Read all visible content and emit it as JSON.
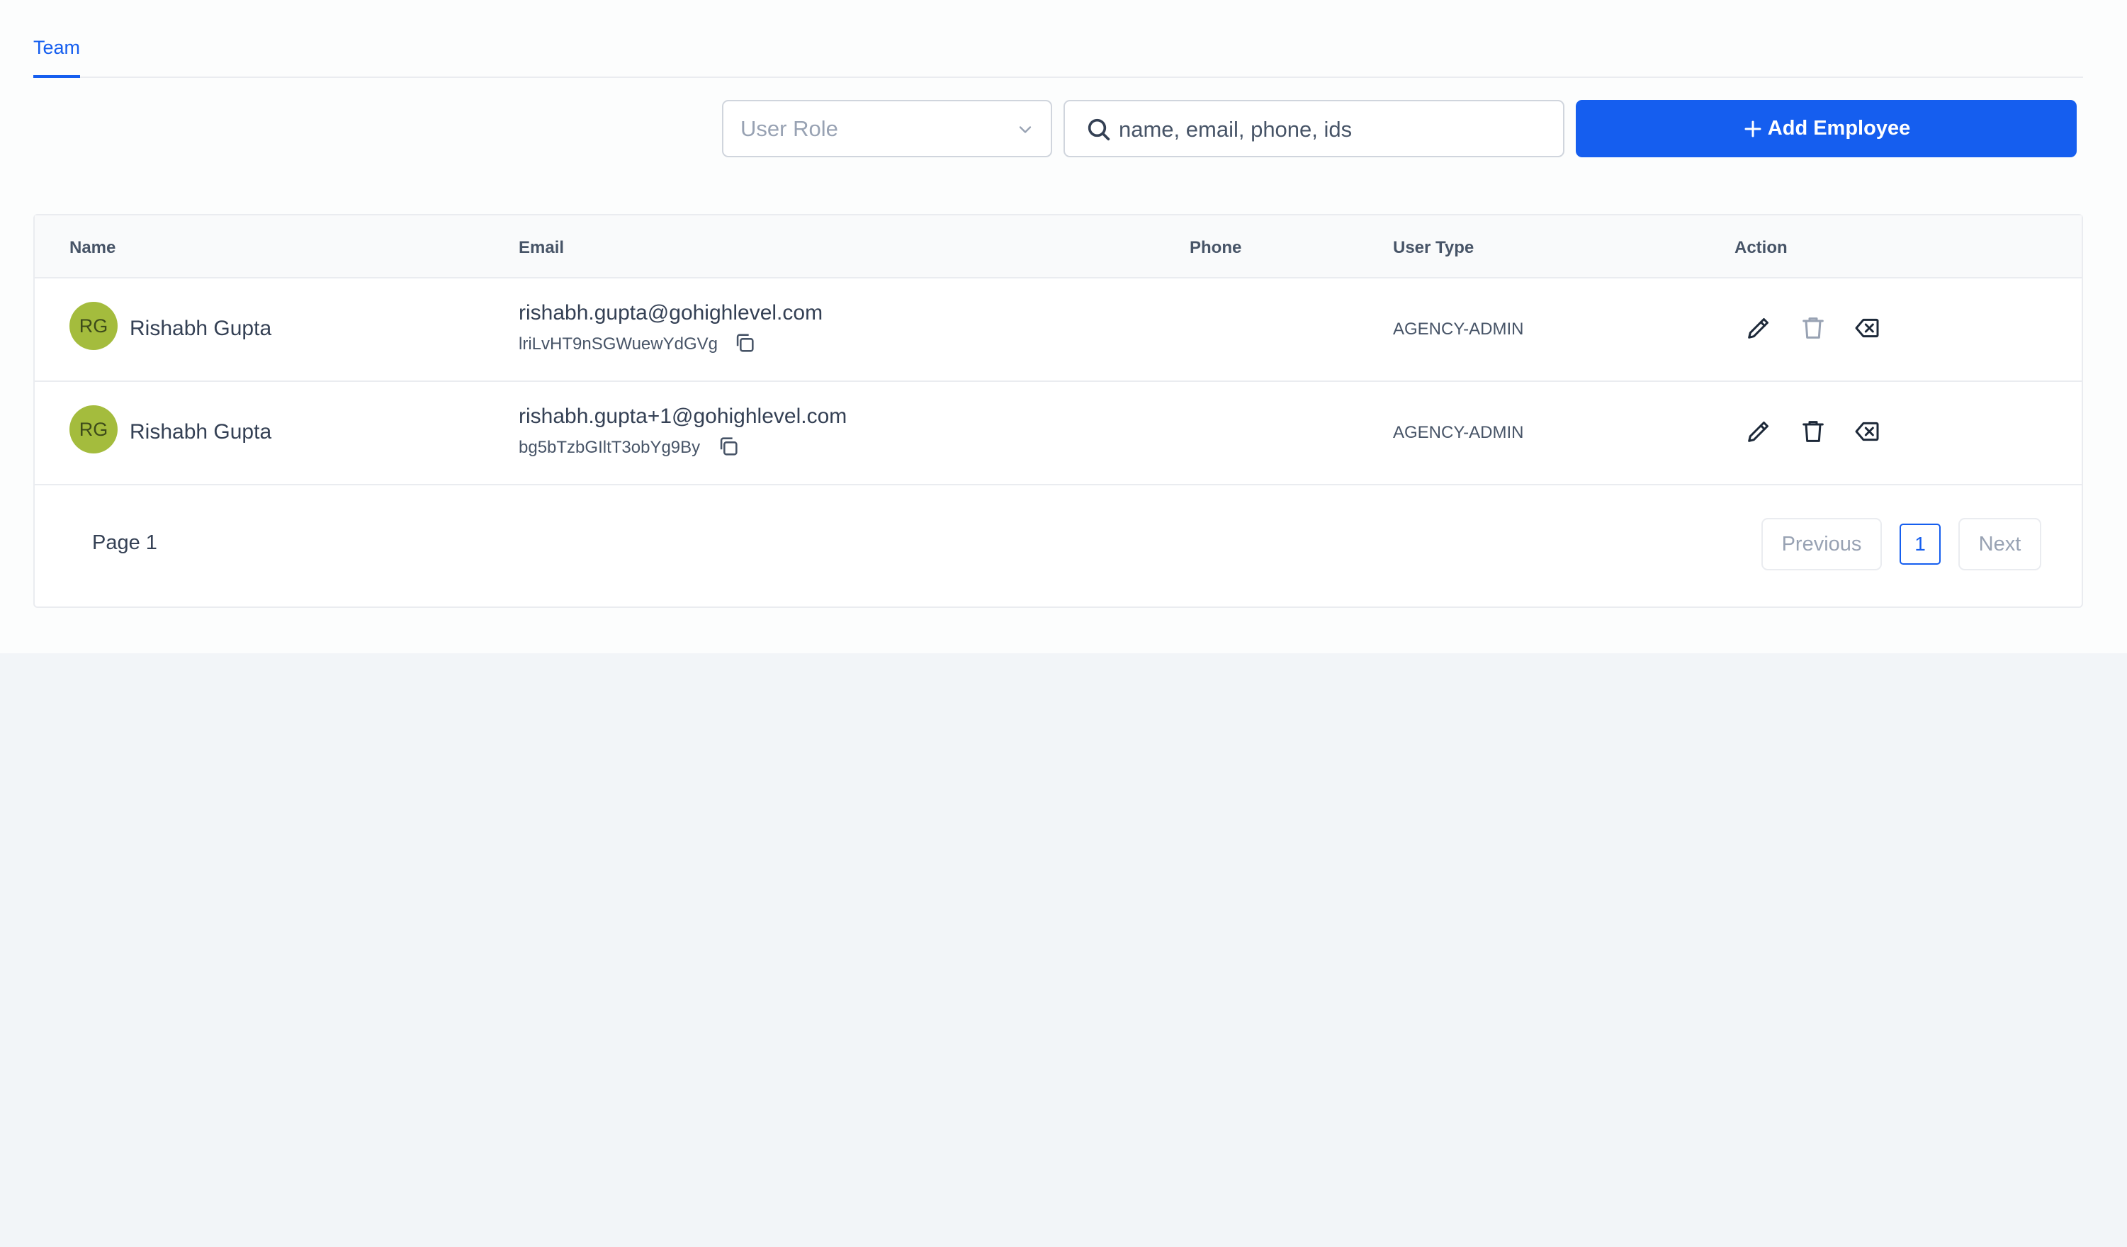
{
  "tabs": [
    {
      "label": "Team"
    }
  ],
  "filters": {
    "user_role_placeholder": "User Role",
    "search_placeholder": "name, email, phone, ids",
    "add_button_label": "Add Employee"
  },
  "table": {
    "headers": [
      "Name",
      "Email",
      "Phone",
      "User Type",
      "Action"
    ],
    "rows": [
      {
        "initials": "RG",
        "name": "Rishabh Gupta",
        "email": "rishabh.gupta@gohighlevel.com",
        "id": "lriLvHT9nSGWuewYdGVg",
        "phone": "",
        "user_type": "AGENCY-ADMIN"
      },
      {
        "initials": "RG",
        "name": "Rishabh Gupta",
        "email": "rishabh.gupta+1@gohighlevel.com",
        "id": "bg5bTzbGIltT3obYg9By",
        "phone": "",
        "user_type": "AGENCY-ADMIN"
      }
    ]
  },
  "pagination": {
    "page_label": "Page 1",
    "previous_label": "Previous",
    "current_page": "1",
    "next_label": "Next"
  },
  "colors": {
    "accent": "#155eef",
    "avatar": "#a4bc3d",
    "background": "#f2f5f8"
  },
  "icons": [
    "search-icon",
    "chevron-down-icon",
    "plus-icon",
    "copy-icon",
    "edit-icon",
    "trash-icon",
    "delete-backspace-icon"
  ]
}
